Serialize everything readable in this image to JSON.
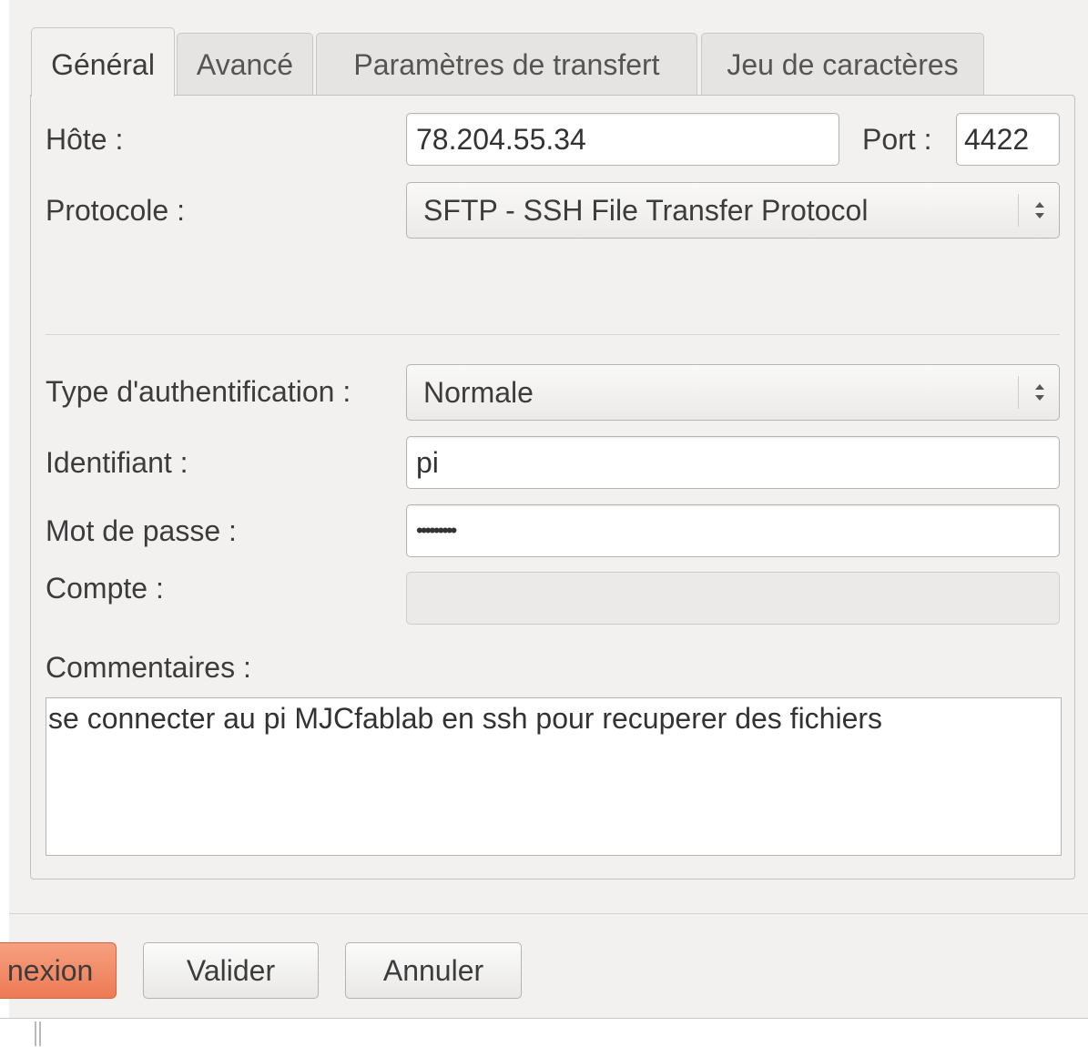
{
  "tabs": [
    {
      "label": "Général",
      "active": true
    },
    {
      "label": "Avancé",
      "active": false
    },
    {
      "label": "Paramètres de transfert",
      "active": false
    },
    {
      "label": "Jeu de caractères",
      "active": false
    }
  ],
  "general": {
    "host_label": "Hôte :",
    "host_value": "78.204.55.34",
    "port_label": "Port :",
    "port_value": "4422",
    "protocol_label": "Protocole :",
    "protocol_value": "SFTP - SSH File Transfer Protocol",
    "auth_label": "Type d'authentification :",
    "auth_value": "Normale",
    "user_label": "Identifiant :",
    "user_value": "pi",
    "password_label": "Mot de passe :",
    "password_value": "•••••••••",
    "account_label": "Compte :",
    "account_value": "",
    "comments_label": "Commentaires :",
    "comments_value": "se connecter au pi MJCfablab en ssh pour recuperer des fichiers"
  },
  "buttons": {
    "connect": "nexion",
    "ok": "Valider",
    "cancel": "Annuler"
  },
  "colors": {
    "accent": "#ee7a55",
    "window_bg": "#f2f1f0"
  }
}
